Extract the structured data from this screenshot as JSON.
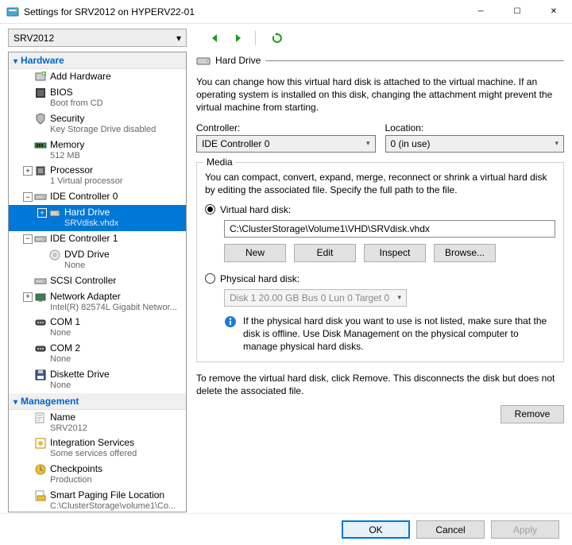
{
  "window": {
    "title": "Settings for SRV2012 on HYPERV22-01"
  },
  "toolbar": {
    "vm_selected": "SRV2012"
  },
  "tree": {
    "hardware_section": "Hardware",
    "management_section": "Management",
    "items": [
      {
        "label": "Add Hardware",
        "sub": "",
        "indent": 1
      },
      {
        "label": "BIOS",
        "sub": "Boot from CD",
        "indent": 1
      },
      {
        "label": "Security",
        "sub": "Key Storage Drive disabled",
        "indent": 1
      },
      {
        "label": "Memory",
        "sub": "512 MB",
        "indent": 1
      },
      {
        "label": "Processor",
        "sub": "1 Virtual processor",
        "indent": 1
      },
      {
        "label": "IDE Controller 0",
        "sub": "",
        "indent": 1
      },
      {
        "label": "Hard Drive",
        "sub": "SRVdisk.vhdx",
        "indent": 2,
        "selected": true
      },
      {
        "label": "IDE Controller 1",
        "sub": "",
        "indent": 1
      },
      {
        "label": "DVD Drive",
        "sub": "None",
        "indent": 2
      },
      {
        "label": "SCSI Controller",
        "sub": "",
        "indent": 1
      },
      {
        "label": "Network Adapter",
        "sub": "Intel(R) 82574L Gigabit Networ...",
        "indent": 1
      },
      {
        "label": "COM 1",
        "sub": "None",
        "indent": 1
      },
      {
        "label": "COM 2",
        "sub": "None",
        "indent": 1
      },
      {
        "label": "Diskette Drive",
        "sub": "None",
        "indent": 1
      }
    ],
    "mgmt": [
      {
        "label": "Name",
        "sub": "SRV2012",
        "indent": 1
      },
      {
        "label": "Integration Services",
        "sub": "Some services offered",
        "indent": 1
      },
      {
        "label": "Checkpoints",
        "sub": "Production",
        "indent": 1
      },
      {
        "label": "Smart Paging File Location",
        "sub": "C:\\ClusterStorage\\volume1\\Co...",
        "indent": 1
      }
    ]
  },
  "detail": {
    "title": "Hard Drive",
    "intro": "You can change how this virtual hard disk is attached to the virtual machine. If an operating system is installed on this disk, changing the attachment might prevent the virtual machine from starting.",
    "controller_label": "Controller:",
    "controller_value": "IDE Controller 0",
    "location_label": "Location:",
    "location_value": "0 (in use)",
    "media_legend": "Media",
    "media_intro": "You can compact, convert, expand, merge, reconnect or shrink a virtual hard disk by editing the associated file. Specify the full path to the file.",
    "vhd_label": "Virtual hard disk:",
    "vhd_path": "C:\\ClusterStorage\\Volume1\\VHD\\SRVdisk.vhdx",
    "btn_new": "New",
    "btn_edit": "Edit",
    "btn_inspect": "Inspect",
    "btn_browse": "Browse...",
    "phys_label": "Physical hard disk:",
    "phys_value": "Disk 1 20.00 GB Bus 0 Lun 0 Target 0",
    "phys_info": "If the physical hard disk you want to use is not listed, make sure that the disk is offline. Use Disk Management on the physical computer to manage physical hard disks.",
    "remove_text": "To remove the virtual hard disk, click Remove. This disconnects the disk but does not delete the associated file.",
    "btn_remove": "Remove"
  },
  "footer": {
    "ok": "OK",
    "cancel": "Cancel",
    "apply": "Apply"
  }
}
